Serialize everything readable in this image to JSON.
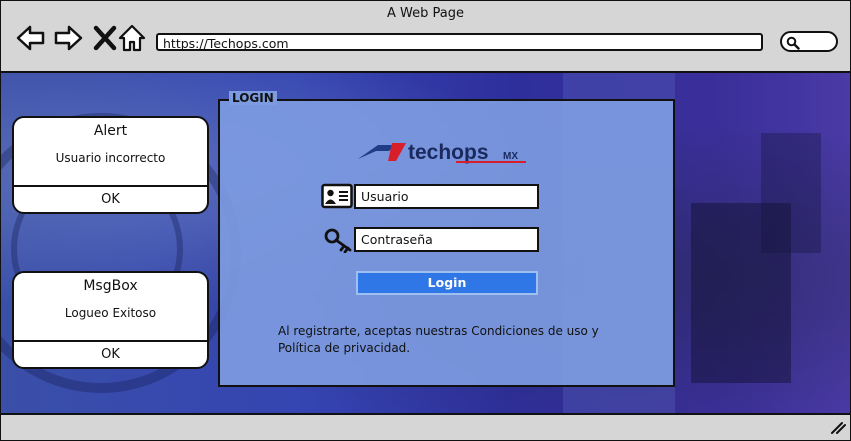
{
  "window": {
    "title": "A Web Page"
  },
  "browser": {
    "url": "https://Techops.com"
  },
  "alert": {
    "title": "Alert",
    "message": "Usuario incorrecto",
    "button": "OK"
  },
  "msgbox": {
    "title": "MsgBox",
    "message": "Logueo Exitoso",
    "button": "OK"
  },
  "login": {
    "legend": "LOGIN",
    "logo_main": "techops",
    "logo_suffix": "MX",
    "username_value": "Usuario",
    "password_value": "Contraseña",
    "submit_label": "Login",
    "terms_line1": "Al registrarte, aceptas nuestras Condiciones de uso y",
    "terms_line2": "Política de privacidad."
  },
  "icons": [
    "back-arrow-icon",
    "forward-arrow-icon",
    "close-x-icon",
    "home-icon",
    "search-icon",
    "user-card-icon",
    "key-icon",
    "resize-grip-icon"
  ],
  "colors": {
    "accent": "#2f76e6",
    "panel": "#7d9be1",
    "logo_blue": "#1f3c88",
    "logo_red": "#d81e2b"
  }
}
